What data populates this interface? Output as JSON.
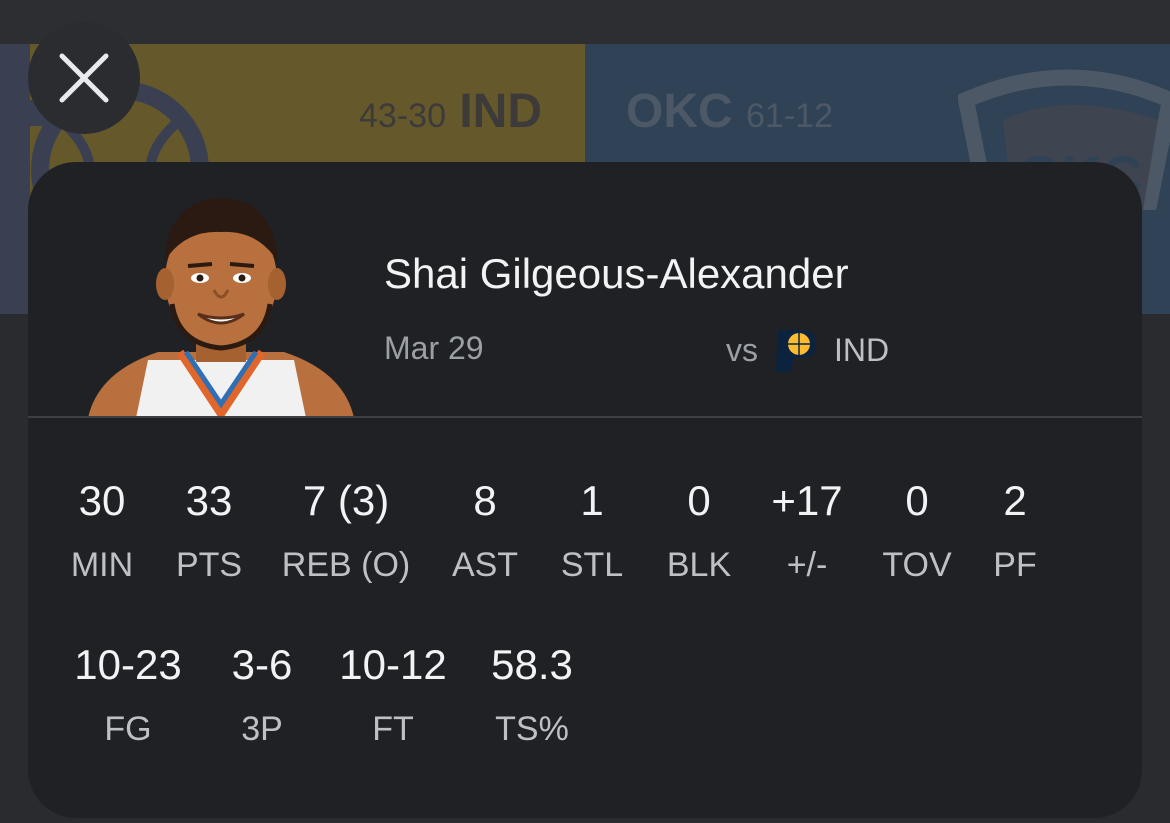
{
  "scoreboard": {
    "home": {
      "record": "43-30",
      "abbr": "IND"
    },
    "away": {
      "abbr": "OKC",
      "record": "61-12"
    }
  },
  "player": {
    "name": "Shai Gilgeous-Alexander",
    "date": "Mar 29",
    "vs_label": "vs",
    "opponent": "IND"
  },
  "stats_row1": [
    {
      "value": "30",
      "label": "MIN"
    },
    {
      "value": "33",
      "label": "PTS"
    },
    {
      "value": "7 (3)",
      "label": "REB (O)"
    },
    {
      "value": "8",
      "label": "AST"
    },
    {
      "value": "1",
      "label": "STL"
    },
    {
      "value": "0",
      "label": "BLK"
    },
    {
      "value": "+17",
      "label": "+/-"
    },
    {
      "value": "0",
      "label": "TOV"
    },
    {
      "value": "2",
      "label": "PF"
    }
  ],
  "stats_row2": [
    {
      "value": "10-23",
      "label": "FG"
    },
    {
      "value": "3-6",
      "label": "3P"
    },
    {
      "value": "10-12",
      "label": "FT"
    },
    {
      "value": "58.3",
      "label": "TS%"
    }
  ],
  "icons": {
    "close": "close-icon",
    "opponent_logo": "pacers-logo-icon"
  },
  "colors": {
    "ind_panel": "#65582a",
    "okc_panel": "#2f4256",
    "card": "#202124"
  }
}
